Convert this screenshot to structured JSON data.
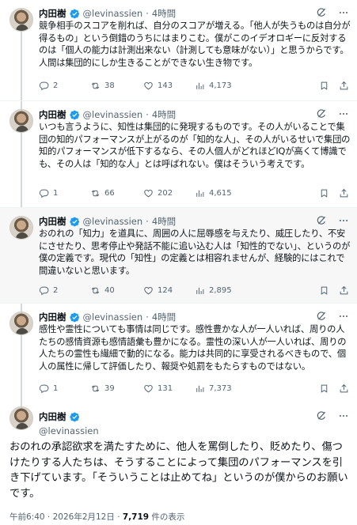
{
  "author": {
    "name": "内田樹",
    "handle": "@levinassien"
  },
  "colors": {
    "verified": "#1d9bf0",
    "text": "#0f1419",
    "muted": "#536471",
    "highlight_bg": "#f7f7f7"
  },
  "tweets": [
    {
      "time": "4時間",
      "text": "競争相手のスコアを削れば、自分のスコアが増える。「他人が失うものは自分が得るもの」という倒錯のうちにはまりこむ。僕がこのイデオロギーに反対するのは「個人の能力は計測出来ない（計測しても意味がない）」と思うからです。人間は集団的にしか生きることができない生き物です。",
      "replies": "2",
      "reposts": "38",
      "likes": "143",
      "views": "4,173"
    },
    {
      "time": "4時間",
      "text": "いつも言うように、知性は集団的に発現するものです。その人がいることで集団の知的パフォーマンスが上がるのが「知的な人」、その人がいるせいで集団の知的パフォーマンスが低下するなら、その人個人がどれほどIQが高くて博識でも、その人は「知的な人」とは呼ばれない。僕はそういう考えです。",
      "replies": "1",
      "reposts": "66",
      "likes": "202",
      "views": "4,615"
    },
    {
      "time": "4時間",
      "text": "おのれの「知力」を道具に、周囲の人に屈辱感を与えたり、威圧したり、不安にさせたり、思考停止や発話不能に追い込む人は「知性的でない」、というのが僕の定義です。現代の「知性」の定義とは相容れませんが、経験的にはこれで間違いないと思います。",
      "replies": "2",
      "reposts": "40",
      "likes": "124",
      "views": "2,895"
    },
    {
      "time": "4時間",
      "text": "感性や霊性についても事情は同じです。感性豊かな人が一人いれば、周りの人たちの感情資源も感情語彙も豊かになる。霊性の深い人が一人いれば、周りの人たちの霊性も繊細で動的になる。能力は共同的に享受されるべきもので、個人の属性に帰して評価したり、報奨や処罰をもたらすものではない。",
      "replies": "1",
      "reposts": "39",
      "likes": "131",
      "views": "7,373"
    }
  ],
  "main_tweet": {
    "text": "おのれの承認欲求を満たすために、他人を罵倒したり、貶めたり、傷つけたりする人たちは、そうすることによって集団のパフォーマンスを引き下げています。「そういうことは止めてね」というのが僕からのお願いです。",
    "timestamp": "午前6:40 · 2026年2月12日 · ",
    "views_count": "7,719",
    "views_suffix": " 件の表示"
  },
  "icons": [
    "verified-badge-icon",
    "grok-icon",
    "more-icon",
    "reply-icon",
    "repost-icon",
    "like-icon",
    "views-icon",
    "bookmark-icon",
    "share-icon"
  ]
}
